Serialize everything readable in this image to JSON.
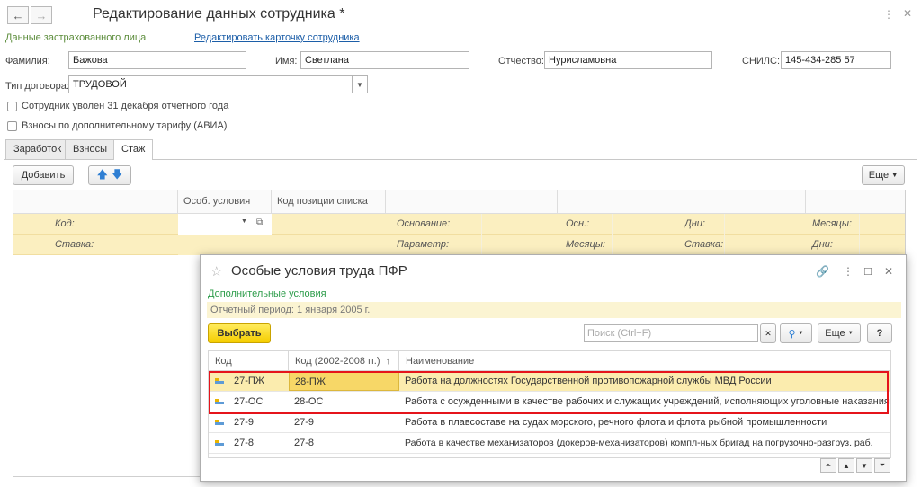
{
  "window": {
    "title": "Редактирование данных сотрудника *",
    "back_icon": "←",
    "forward_icon": "→"
  },
  "header": {
    "subtitle": "Данные застрахованного лица",
    "edit_link": "Редактировать карточку сотрудника"
  },
  "person": {
    "surname_label": "Фамилия:",
    "surname": "Бажова",
    "name_label": "Имя:",
    "name": "Светлана",
    "patronymic_label": "Отчество:",
    "patronymic": "Нурисламовна",
    "snils_label": "СНИЛС:",
    "snils": "145-434-285 57"
  },
  "contract": {
    "label": "Тип договора:",
    "value": "ТРУДОВОЙ"
  },
  "checkboxes": [
    {
      "label": "Сотрудник уволен 31 декабря отчетного года",
      "checked": false
    },
    {
      "label": "Взносы по дополнительному тарифу (АВИА)",
      "checked": false
    }
  ],
  "tabs": [
    {
      "label": "Заработок",
      "active": false
    },
    {
      "label": "Взносы",
      "active": false
    },
    {
      "label": "Стаж",
      "active": true
    }
  ],
  "toolbar": {
    "add_label": "Добавить",
    "more_label": "Еще"
  },
  "main_grid": {
    "columns": [
      "Особ. условия",
      "Код позиции списка"
    ],
    "row1": [
      "Код:",
      "Основание:",
      "Осн.:",
      "Дни:",
      "Месяцы:"
    ],
    "row2": [
      "Ставка:",
      "Параметр:",
      "Месяцы:",
      "Ставка:",
      "Дни:"
    ]
  },
  "modal": {
    "title": "Особые условия труда ПФР",
    "section": "Дополнительные условия",
    "period": "Отчетный период: 1 января 2005 г.",
    "select_label": "Выбрать",
    "search_placeholder": "Поиск (Ctrl+F)",
    "more_label": "Еще",
    "help_label": "?",
    "columns": [
      "Код",
      "Код (2002-2008 гг.)",
      "Наименование"
    ],
    "sort_icon": "↑",
    "rows": [
      {
        "code": "27-ПЖ",
        "code_old": "28-ПЖ",
        "name": "Работа на должностях Государственной противопожарной службы МВД России"
      },
      {
        "code": "27-ОС",
        "code_old": "28-ОС",
        "name": "Работа с осужденными в качестве рабочих и служащих учреждений, исполняющих уголовные наказания"
      },
      {
        "code": "27-9",
        "code_old": "27-9",
        "name": "Работа в плавсоставе на судах морского, речного флота и флота рыбной промышленности"
      },
      {
        "code": "27-8",
        "code_old": "27-8",
        "name": "Работа в качестве механизаторов (докеров-механизаторов) компл-ных бригад на погрузочно-разгруз. раб."
      }
    ]
  },
  "colors": {
    "yellow_row": "#fbefc0",
    "selection": "#fbecae",
    "highlight_border": "#e5141b",
    "button_yellow": "#f5cd00"
  }
}
